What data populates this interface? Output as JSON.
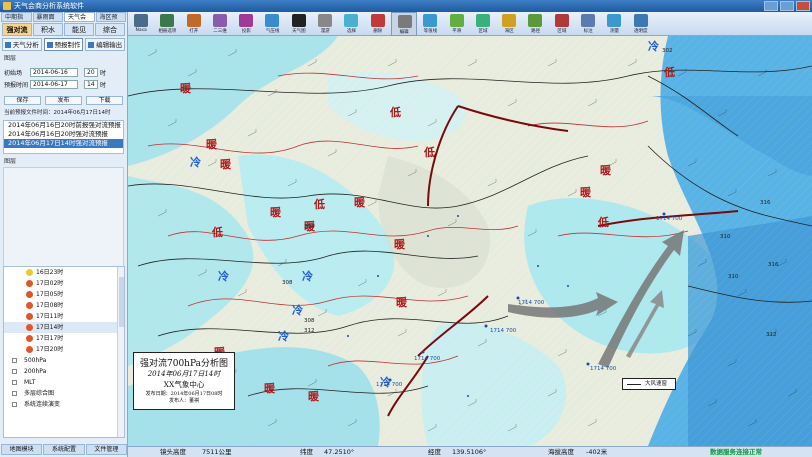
{
  "window": {
    "title": "天气会商分析系统软件"
  },
  "left": {
    "system_tabs": [
      "中期指数",
      "暴雨面板",
      "天气会商",
      "海区预报"
    ],
    "mode_tabs": [
      "强对流",
      "积水",
      "能见",
      "综合"
    ],
    "sub_tabs": [
      {
        "label": "天气分析",
        "active": false
      },
      {
        "label": "预报制作",
        "active": true
      },
      {
        "label": "编辑输出",
        "active": false
      }
    ],
    "form": {
      "start_label": "初始场",
      "start_date": "2014-06-16",
      "start_hour": "20",
      "hour_unit": "时",
      "forecast_label": "预报时间",
      "forecast_date": "2014-06-17",
      "forecast_hour": "14"
    },
    "buttons": [
      "保存",
      "发布",
      "下载"
    ],
    "file_time": "当前预报文件时间：2014年06月17日14时",
    "forecast_list": [
      "2014年06月16日20时前报强对流预报",
      "2014年06月16日20时强对流预报",
      "2014年06月17日14时强对流预报"
    ],
    "section_label": "图层",
    "analysis_label": "分析",
    "tree_items": [
      {
        "label": "16日23时",
        "dot": "yellow",
        "hl": false
      },
      {
        "label": "17日02时",
        "dot": "red",
        "hl": false
      },
      {
        "label": "17日05时",
        "dot": "red",
        "hl": false
      },
      {
        "label": "17日08时",
        "dot": "red",
        "hl": false
      },
      {
        "label": "17日11时",
        "dot": "red",
        "hl": false
      },
      {
        "label": "17日14时",
        "dot": "red",
        "hl": true
      },
      {
        "label": "17日17时",
        "dot": "red",
        "hl": false
      },
      {
        "label": "17日20时",
        "dot": "red",
        "hl": false
      }
    ],
    "tree_groups": [
      "500hPa",
      "200hPa",
      "MLT",
      "多层综合图",
      "系统连续演变"
    ],
    "bottom_buttons": [
      "地图模块",
      "系统配置",
      "文件管理"
    ]
  },
  "toolbar": [
    "Nasa",
    "相册选项",
    "打开",
    "二三维",
    "投影",
    "气压线",
    "天气图",
    "漫游",
    "选择",
    "删除",
    "编辑",
    "等值线",
    "平滑",
    "区域",
    "海区",
    "路径",
    "区域",
    "标注",
    "测量",
    "透明度"
  ],
  "map": {
    "labels": [
      {
        "t": "低",
        "type": "warm"
      },
      {
        "t": "低",
        "type": "warm"
      },
      {
        "t": "暖",
        "type": "warm"
      },
      {
        "t": "低",
        "type": "warm"
      },
      {
        "t": "冷",
        "type": "cold"
      },
      {
        "t": "暖",
        "type": "warm"
      },
      {
        "t": "冷",
        "type": "cold"
      },
      {
        "t": "暖",
        "type": "warm"
      },
      {
        "t": "暖",
        "type": "warm"
      },
      {
        "t": "低",
        "type": "warm"
      },
      {
        "t": "暖",
        "type": "warm"
      },
      {
        "t": "暖",
        "type": "warm"
      },
      {
        "t": "低",
        "type": "warm"
      },
      {
        "t": "暖",
        "type": "warm"
      },
      {
        "t": "冷",
        "type": "cold"
      },
      {
        "t": "冷",
        "type": "cold"
      },
      {
        "t": "冷",
        "type": "cold"
      },
      {
        "t": "暖",
        "type": "warm"
      },
      {
        "t": "冷",
        "type": "cold"
      },
      {
        "t": "暖",
        "type": "warm"
      },
      {
        "t": "暖",
        "type": "warm"
      },
      {
        "t": "暖",
        "type": "warm"
      },
      {
        "t": "冷",
        "type": "cold"
      },
      {
        "t": "低",
        "type": "warm"
      },
      {
        "t": "暖",
        "type": "warm"
      },
      {
        "t": "暖",
        "type": "warm"
      }
    ],
    "stations": [
      "1714 700",
      "1714 700",
      "1714 700",
      "1714 700",
      "1714 700",
      "1714 700"
    ],
    "contours": [
      "304",
      "308",
      "312",
      "316",
      "302",
      "310",
      "310",
      "316",
      "308",
      "312"
    ]
  },
  "titlebox": {
    "title": "强对流700hPa分析图",
    "time": "2014年06月17日14时",
    "center": "XX气象中心",
    "issue": "发布日期：2014年06月17日08时",
    "author": "发布人：董祺"
  },
  "legend": {
    "label": "大风速窗"
  },
  "status": {
    "cam_label": "镜头高度",
    "cam_value": "7511公里",
    "lat_label": "纬度",
    "lat_value": "47.2510°",
    "lon_label": "经度",
    "lon_value": "139.5106°",
    "alt_label": "海拔高度",
    "alt_value": "-402米",
    "conn": "数据服务连接正常"
  },
  "colors": {
    "warm": "#b01818",
    "cold": "#1e5fd6",
    "accent": "#3a78c0",
    "ok": "#0a9a3a"
  }
}
